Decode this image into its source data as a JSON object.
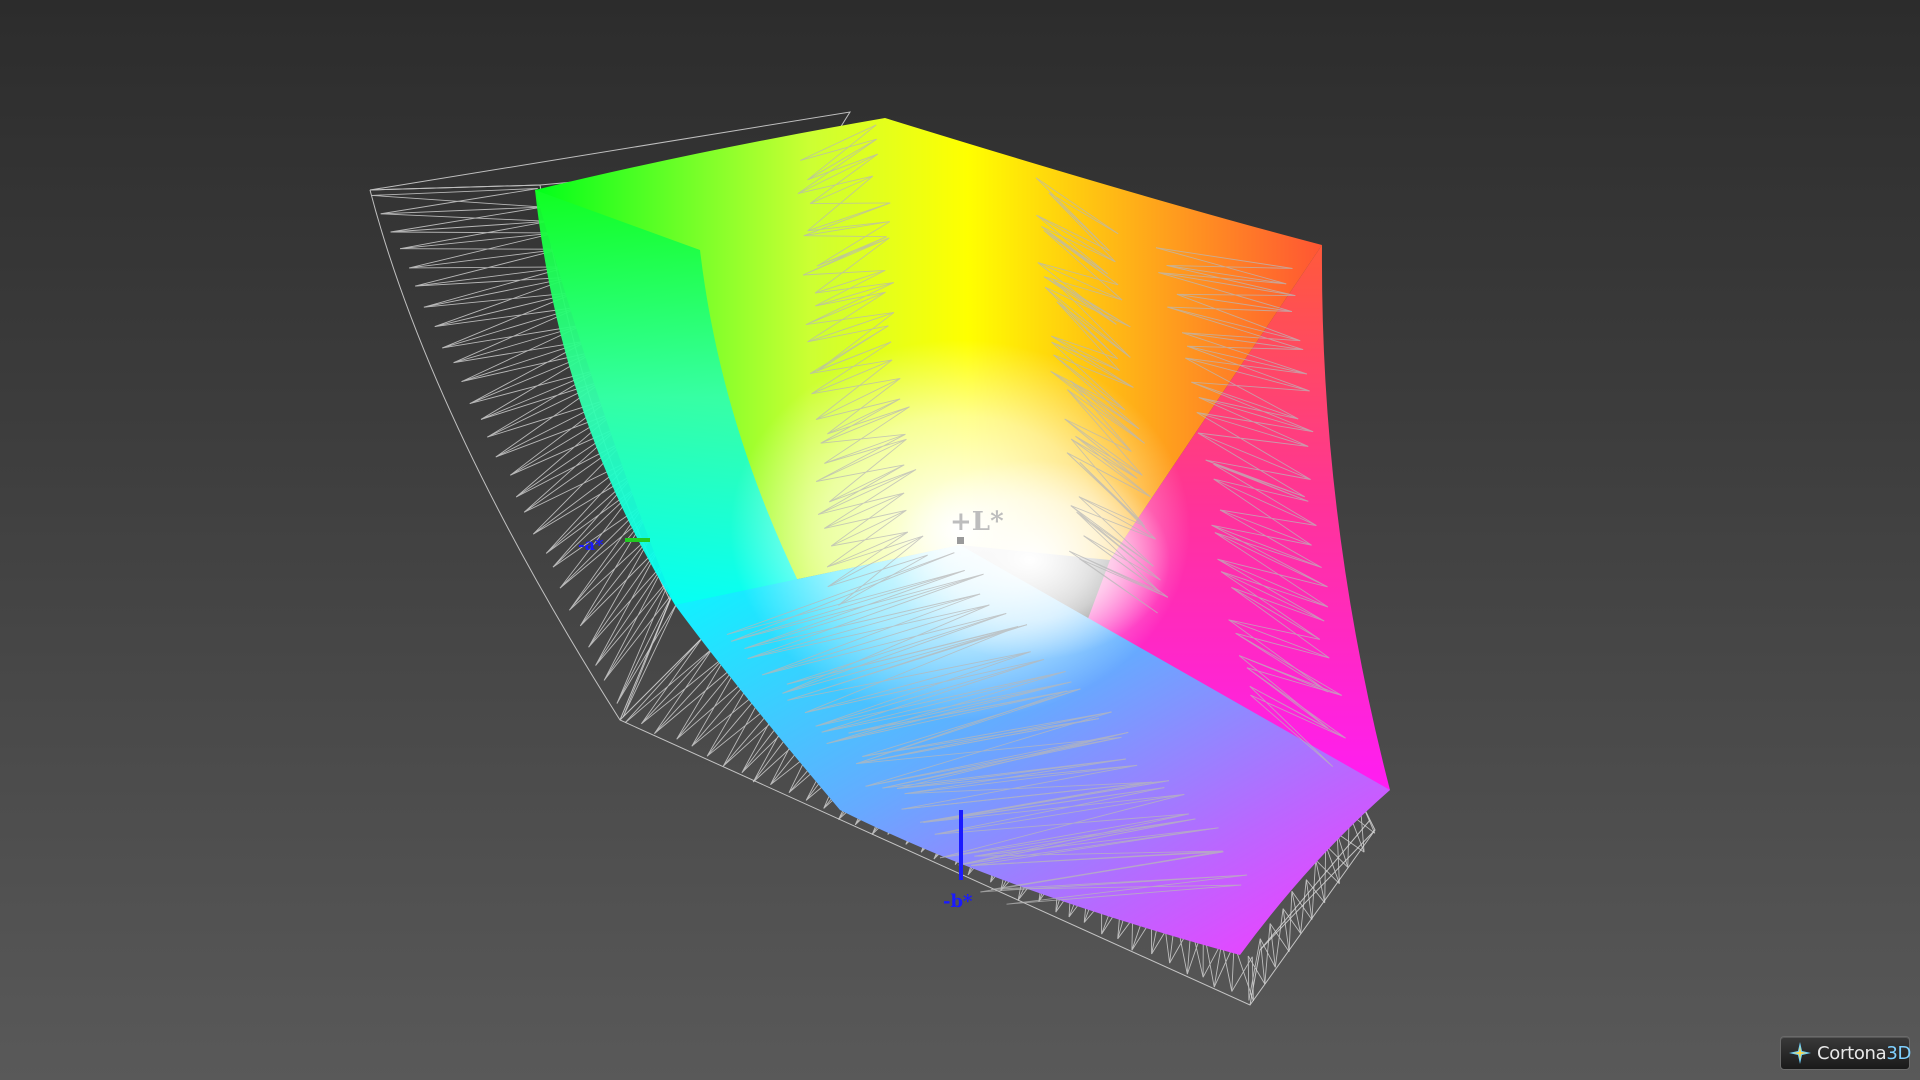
{
  "viewer": {
    "name": "Cortona3D",
    "logo_main": "Cortona",
    "logo_suffix": "3D"
  },
  "axes": {
    "l_label": "+L*",
    "a_label": "-a*",
    "b_label": "-b*"
  },
  "colors": {
    "background_top": "#2c2c2c",
    "background_bottom": "#595959",
    "wireframe": "#d8d8d8",
    "axis_a": "#22cc22",
    "axis_b": "#1a1aff",
    "axis_label_b": "#1a1aff",
    "axis_label_l": "#bdbdbd",
    "gamut_green": "#00ff00",
    "gamut_yellow": "#ffff00",
    "gamut_red": "#ff3300",
    "gamut_magenta": "#ff00ff",
    "gamut_cyan": "#00ffff",
    "gamut_blue": "#7a5cff",
    "gamut_white": "#ffffff"
  },
  "icons": [
    "cortona-star-icon"
  ]
}
